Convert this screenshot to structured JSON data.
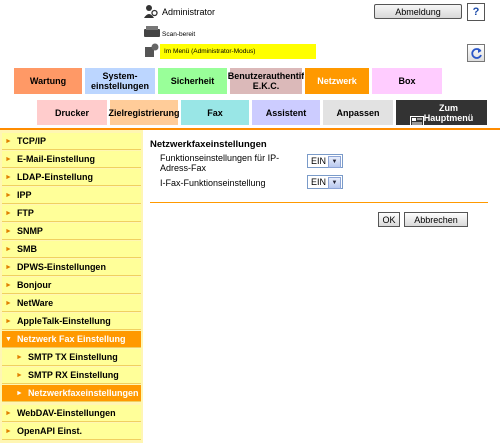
{
  "header": {
    "user": "Administrator",
    "logout_label": "Abmeldung",
    "help_label": "?",
    "status": "Scan-bereit",
    "mode": "Im Menü (Administrator-Modus)"
  },
  "tabs_top": [
    {
      "label": "Wartung"
    },
    {
      "label": "System-\neinstellungen"
    },
    {
      "label": "Sicherheit"
    },
    {
      "label": "Benutzerauthentif\nE.K.C."
    },
    {
      "label": "Netzwerk"
    },
    {
      "label": "Box"
    }
  ],
  "tabs_bottom": [
    {
      "label": "Drucker"
    },
    {
      "label": "Zielregistrierung"
    },
    {
      "label": "Fax"
    },
    {
      "label": "Assistent"
    },
    {
      "label": "Anpassen"
    },
    {
      "label": "Zum\nHauptmenü"
    }
  ],
  "sidebar": {
    "items": [
      {
        "label": "TCP/IP"
      },
      {
        "label": "E-Mail-Einstellung"
      },
      {
        "label": "LDAP-Einstellung"
      },
      {
        "label": "IPP"
      },
      {
        "label": "FTP"
      },
      {
        "label": "SNMP"
      },
      {
        "label": "SMB"
      },
      {
        "label": "DPWS-Einstellungen"
      },
      {
        "label": "Bonjour"
      },
      {
        "label": "NetWare"
      },
      {
        "label": "AppleTalk-Einstellung"
      },
      {
        "label": "Netzwerk Fax Einstellung"
      },
      {
        "label": "SMTP TX Einstellung"
      },
      {
        "label": "SMTP RX Einstellung"
      },
      {
        "label": "Netzwerkfaxeinstellungen"
      },
      {
        "label": "WebDAV-Einstellungen"
      },
      {
        "label": "OpenAPI Einst."
      }
    ]
  },
  "main": {
    "title": "Netzwerkfaxeinstellungen",
    "fields": [
      {
        "label": "Funktionseinstellungen für IP-Adress-Fax",
        "value": "EIN"
      },
      {
        "label": "I-Fax-Funktionseinstellung",
        "value": "EIN"
      }
    ],
    "ok_label": "OK",
    "cancel_label": "Abbrechen"
  },
  "colors": {
    "accent": "#ff9900",
    "sidebar_bg": "#ffff99",
    "mode_bar": "#ffff00"
  }
}
